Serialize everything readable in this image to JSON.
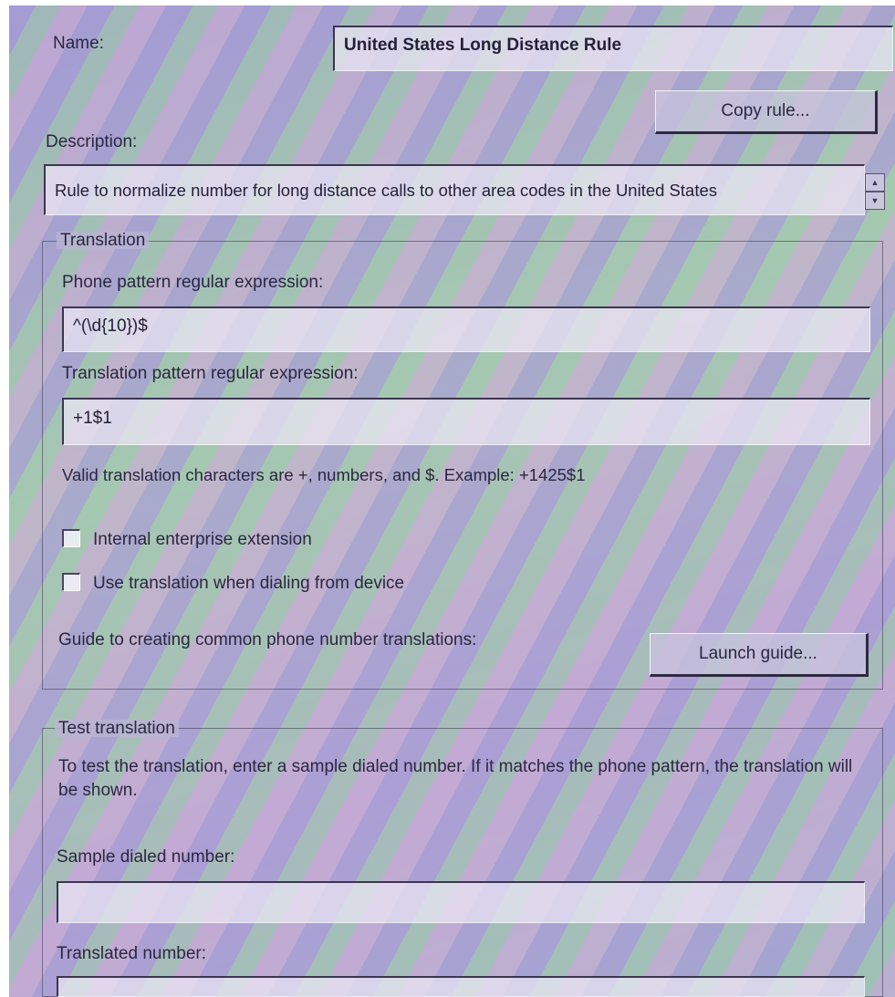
{
  "rule": {
    "name_label": "Name:",
    "name_value": "United States Long Distance Rule",
    "copy_button": "Copy rule...",
    "description_label": "Description:",
    "description_value": "Rule to normalize number for long distance calls to other area codes in the United States"
  },
  "translation": {
    "legend": "Translation",
    "phone_pattern_label": "Phone pattern regular expression:",
    "phone_pattern_value": "^(\\d{10})$",
    "translation_pattern_label": "Translation pattern regular expression:",
    "translation_pattern_value": "+1$1",
    "help_text": "Valid translation characters are +, numbers, and $. Example: +1425$1",
    "checkbox_internal_extension": "Internal enterprise extension",
    "checkbox_internal_extension_checked": false,
    "checkbox_use_translation": "Use translation when dialing from device",
    "checkbox_use_translation_checked": false,
    "guide_label": "Guide to creating common phone number translations:",
    "launch_button": "Launch guide..."
  },
  "test": {
    "legend": "Test translation",
    "instructions": "To test the translation, enter a sample dialed number. If it matches the phone pattern, the translation will be shown.",
    "sample_label": "Sample dialed number:",
    "sample_value": "",
    "translated_label": "Translated number:",
    "translated_value": ""
  },
  "icons": {
    "scroll_up": "triangle-up-icon",
    "scroll_down": "triangle-down-icon"
  },
  "colors": {
    "text": "#2b2740",
    "field_bg": "#ece8f5",
    "frame": "#3b3550"
  }
}
